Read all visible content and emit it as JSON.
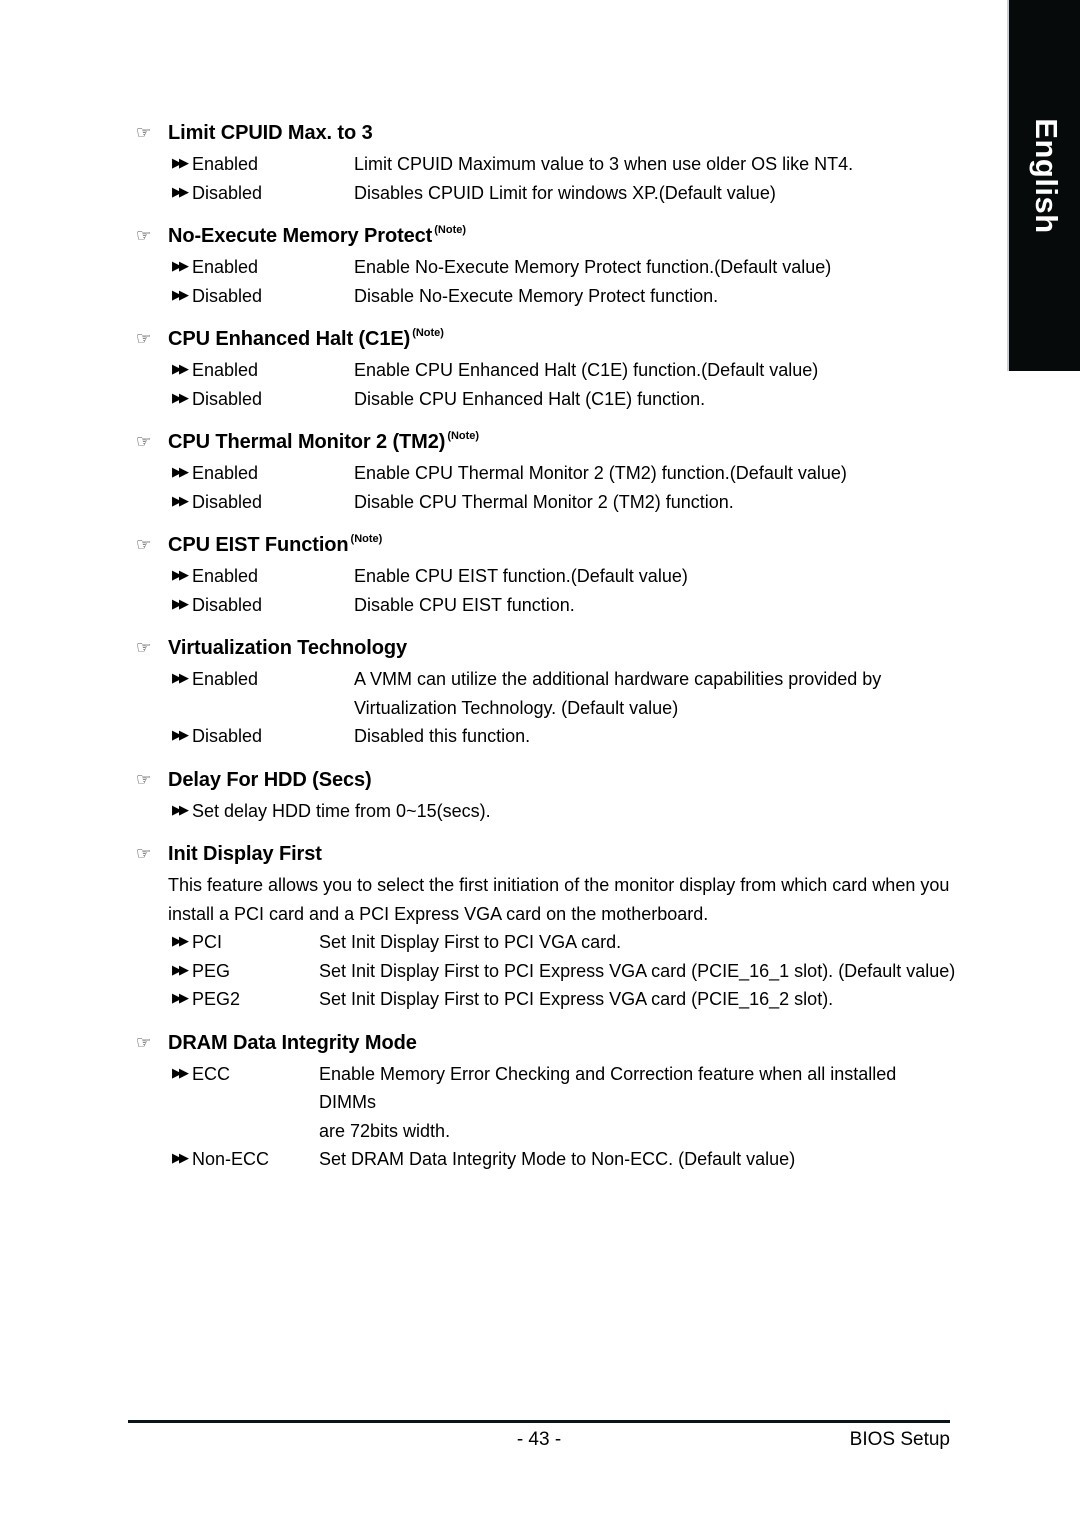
{
  "language_tab": {
    "label": "English"
  },
  "icons": {
    "hand_pointer": "☞",
    "double_arrow": "▶▶"
  },
  "footer": {
    "page_number": "- 43 -",
    "doc_label": "BIOS Setup"
  },
  "sections": [
    {
      "heading": "Limit CPUID Max. to 3",
      "note": "",
      "paragraph": [],
      "options": [
        {
          "label": "Enabled",
          "desc": "Limit CPUID Maximum value to 3 when use older OS like NT4."
        },
        {
          "label": "Disabled",
          "desc": "Disables CPUID Limit for windows XP.(Default value)"
        }
      ]
    },
    {
      "heading": "No-Execute Memory Protect",
      "note": "(Note)",
      "paragraph": [],
      "options": [
        {
          "label": "Enabled",
          "desc": "Enable No-Execute Memory Protect function.(Default value)"
        },
        {
          "label": "Disabled",
          "desc": "Disable No-Execute Memory Protect function."
        }
      ]
    },
    {
      "heading": "CPU Enhanced Halt (C1E)",
      "note": "(Note)",
      "paragraph": [],
      "options": [
        {
          "label": "Enabled",
          "desc": "Enable CPU Enhanced Halt (C1E) function.(Default value)"
        },
        {
          "label": "Disabled",
          "desc": "Disable CPU Enhanced Halt (C1E) function."
        }
      ]
    },
    {
      "heading": "CPU Thermal Monitor 2 (TM2)",
      "note": "(Note)",
      "paragraph": [],
      "options": [
        {
          "label": "Enabled",
          "desc": "Enable CPU Thermal Monitor 2 (TM2) function.(Default value)"
        },
        {
          "label": "Disabled",
          "desc": "Disable CPU Thermal Monitor 2 (TM2) function."
        }
      ]
    },
    {
      "heading": "CPU EIST Function",
      "note": "(Note)",
      "paragraph": [],
      "options": [
        {
          "label": "Enabled",
          "desc": "Enable CPU EIST function.(Default value)"
        },
        {
          "label": "Disabled",
          "desc": "Disable CPU EIST function."
        }
      ]
    },
    {
      "heading": "Virtualization Technology",
      "note": "",
      "paragraph": [],
      "options": [
        {
          "label": "Enabled",
          "desc": "A VMM can utilize the additional hardware capabilities provided by",
          "desc_line2": "Virtualization Technology. (Default value)"
        },
        {
          "label": "Disabled",
          "desc": "Disabled this function."
        }
      ]
    },
    {
      "heading": "Delay For HDD (Secs)",
      "note": "",
      "paragraph": [],
      "options": [
        {
          "label": "Set delay HDD time from 0~15(secs).",
          "desc": "",
          "inline": true
        }
      ]
    },
    {
      "heading": "Init Display First",
      "note": "",
      "paragraph": [
        "This feature allows you to select the first initiation of the monitor display from which card when you",
        "install a PCI card and a PCI Express VGA card on the motherboard."
      ],
      "options": [
        {
          "label": "PCI",
          "desc": "Set Init Display First to PCI VGA card."
        },
        {
          "label": "PEG",
          "desc": "Set Init Display First to PCI Express VGA card (PCIE_16_1 slot). (Default value)"
        },
        {
          "label": "PEG2",
          "desc": "Set Init Display First to PCI Express VGA card (PCIE_16_2 slot)."
        }
      ]
    },
    {
      "heading": "DRAM Data Integrity Mode",
      "note": "",
      "paragraph": [],
      "options": [
        {
          "label": "ECC",
          "desc": "Enable Memory Error Checking and Correction feature when all installed DIMMs",
          "desc_line2": "are 72bits width."
        },
        {
          "label": "Non-ECC",
          "desc": "Set DRAM Data Integrity Mode to Non-ECC. (Default value)"
        }
      ]
    }
  ]
}
